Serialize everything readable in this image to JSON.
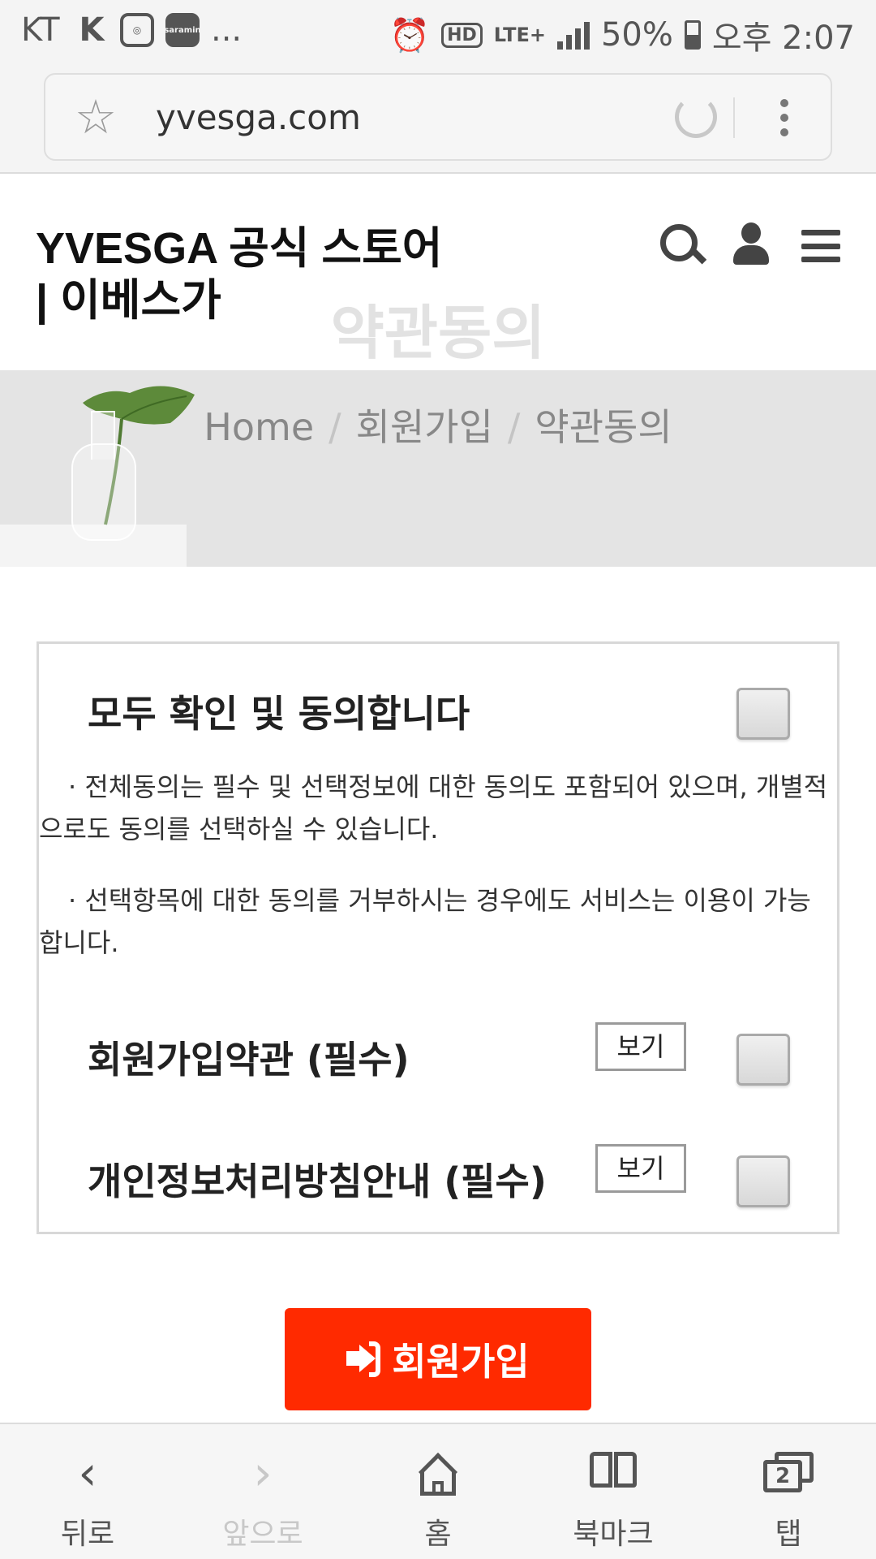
{
  "status_bar": {
    "carrier": "KT",
    "notification_icons": [
      "k-icon",
      "instagram-icon",
      "saramin-icon"
    ],
    "saramin_label": "saramin",
    "more": "...",
    "hd_label": "HD",
    "network": "LTE+",
    "battery": "50%",
    "time": "오후 2:07"
  },
  "browser": {
    "url": "yvesga.com"
  },
  "site": {
    "title": "YVESGA 공식 스토어 | 이베스가",
    "page_title": "약관동의"
  },
  "breadcrumb": {
    "items": [
      "Home",
      "회원가입",
      "약관동의"
    ],
    "separator": "/"
  },
  "agreement": {
    "all_label": "모두 확인 및 동의합니다",
    "notice_1": "· 전체동의는 필수 및 선택정보에 대한 동의도 포함되어 있으며, 개별적으로도 동의를 선택하실 수 있습니다.",
    "notice_2": "· 선택항목에 대한 동의를 거부하시는 경우에도 서비스는 이용이 가능합니다.",
    "items": [
      {
        "label": "회원가입약관 (필수)",
        "view_label": "보기"
      },
      {
        "label": "개인정보처리방침안내 (필수)",
        "view_label": "보기"
      }
    ]
  },
  "join_button": {
    "label": "회원가입"
  },
  "bottom_nav": {
    "items": [
      {
        "label": "뒤로",
        "glyph": "‹"
      },
      {
        "label": "앞으로",
        "glyph": "›"
      },
      {
        "label": "홈"
      },
      {
        "label": "북마크"
      },
      {
        "label": "탭",
        "count": "2"
      }
    ]
  },
  "colors": {
    "accent": "#ff2a00",
    "banner_bg": "#e4e4e4"
  }
}
